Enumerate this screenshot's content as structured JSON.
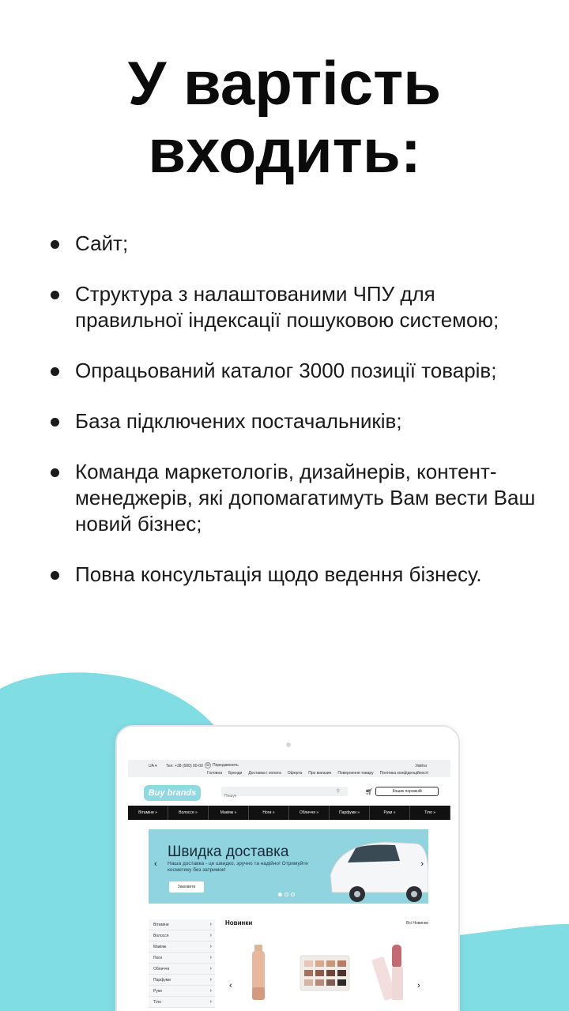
{
  "headline": {
    "line1": "У вартість",
    "line2": "входить:"
  },
  "bullets": [
    "Сайт;",
    "Структура з налаштованими ЧПУ для правильної індексації пошуковою системою;",
    "Опрацьований каталог 3000 позиції товарів;",
    "База підключених постачальників;",
    "Команда маркетологів, дизайнерів, контент-менеджерів, які допомагатимуть Вам вести Ваш новий бізнес;",
    "Повна консультація щодо ведення бізнесу."
  ],
  "colors": {
    "accent": "#80dde3",
    "text": "#111111",
    "banner": "#8fd4de"
  },
  "site": {
    "topbar": {
      "lang": "UA",
      "phone": "Тел: +38 (000) 00-00",
      "callback": "Передзвонить",
      "login": "Увійти",
      "nav": [
        "Головна",
        "Бренди",
        "Доставка і оплата",
        "Оферта",
        "Про магазин",
        "Повернення товару",
        "Політика конфіденційності"
      ]
    },
    "logo": "Buy brands",
    "search_placeholder": "Пошук",
    "cart_label": "Кошик порожній",
    "categories": [
      "Вітаміни »",
      "Волосся »",
      "Макіяж »",
      "Ноги »",
      "Обличчя »",
      "Парфуми »",
      "Руки »",
      "Тіло »"
    ],
    "banner": {
      "title": "Швидка доставка",
      "text": "Наша доставка - це швидко, зручно та надійно! Отримуйте косметику без затримок!",
      "button": "Замовити"
    },
    "sidebar": [
      "Вітаміни",
      "Волосся",
      "Макіяж",
      "Ноги",
      "Обличчя",
      "Парфуми",
      "Руки",
      "Тіло"
    ],
    "new_products": {
      "title": "Новинки",
      "all_link": "Всі Новинки"
    }
  }
}
